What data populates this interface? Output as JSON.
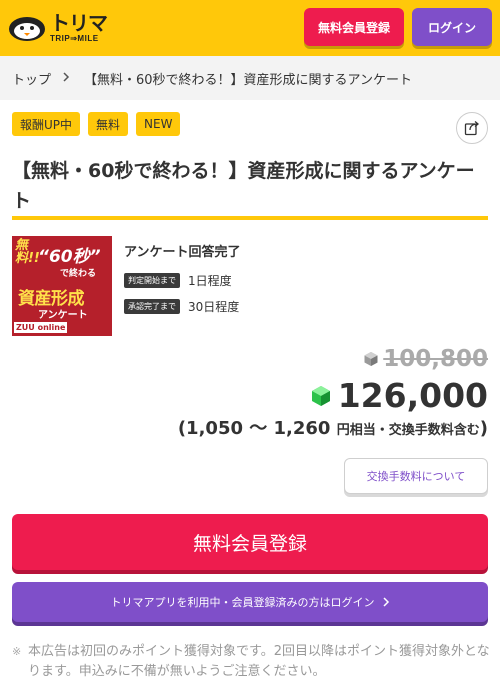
{
  "header": {
    "logo_title": "トリマ",
    "logo_sub": "TRIP⇒MILE",
    "register_label": "無料会員登録",
    "login_label": "ログイン"
  },
  "breadcrumb": {
    "home": "トップ",
    "current": "【無料・60秒で終わる！】資産形成に関するアンケート"
  },
  "tags": [
    "報酬UP中",
    "無料",
    "NEW"
  ],
  "title": "【無料・60秒で終わる！】資産形成に関するアンケート",
  "banner": {
    "free": "無料!!",
    "sixty": "“60秒”",
    "end": "で終わる",
    "main": "資産形成",
    "anq": "アンケート",
    "brand": "ZUU online"
  },
  "conditions": {
    "title": "アンケート回答完了",
    "rows": [
      {
        "badge": "判定開始まで",
        "value": "1日程度"
      },
      {
        "badge": "承認完了まで",
        "value": "30日程度"
      }
    ]
  },
  "points": {
    "old": "100,800",
    "new": "126,000",
    "yen_range": "(1,050 〜 1,260",
    "yen_suffix": "円相当・交換手数料含む",
    "yen_close": ")"
  },
  "fee_button": "交換手数料について",
  "big_register": "無料会員登録",
  "login_bar": "トリマアプリを利用中・会員登録済みの方はログイン",
  "notice": {
    "mark": "※",
    "text": "本広告は初回のみポイント獲得対象です。2回目以降はポイント獲得対象外となります。申込みに不備が無いようご注意ください。"
  },
  "colors": {
    "brand_yellow": "#ffc80a",
    "register_red": "#ee1c4e",
    "login_purple": "#7f4fc9"
  },
  "icons": {
    "share": "share-icon",
    "gem_old": "gray-gem-icon",
    "gem_new": "green-gem-icon",
    "chevron": "chevron-right-icon"
  }
}
